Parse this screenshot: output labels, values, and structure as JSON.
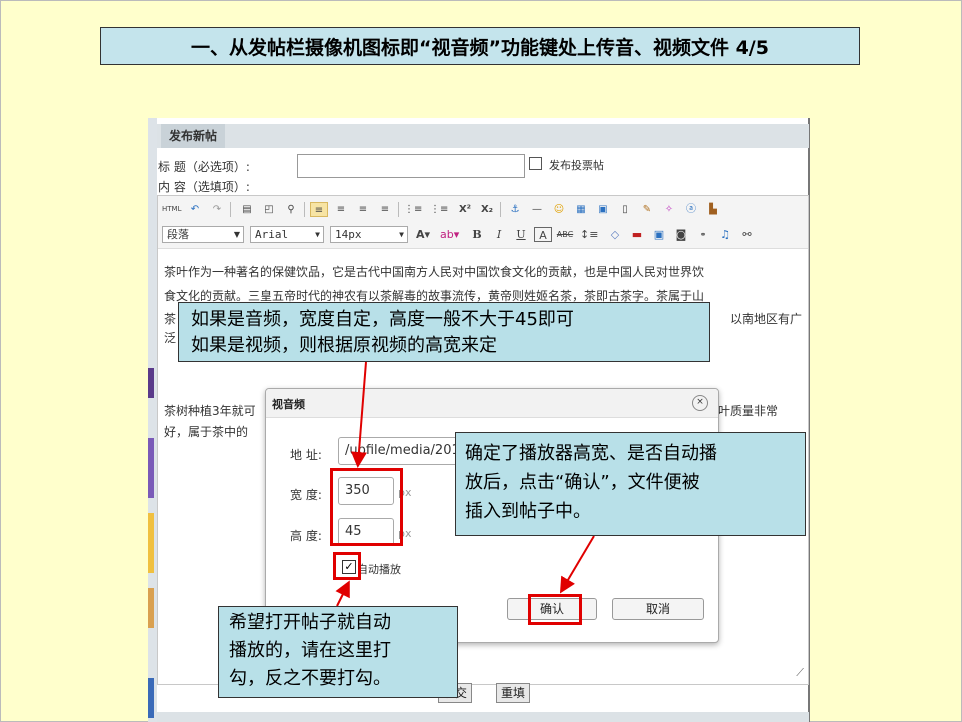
{
  "slide": {
    "title": "一、从发帖栏摄像机图标即“视音频”功能键处上传音、视频文件 4/5"
  },
  "form": {
    "header": "发布新帖",
    "title_label": "标  题（必选项）:",
    "content_label": "内  容（选填项）:",
    "vote_label": "发布投票帖"
  },
  "toolbar": {
    "row1_icons": [
      "html-icon",
      "undo-icon",
      "redo-icon",
      "print-icon",
      "preview-icon",
      "find-icon",
      "align-left-icon",
      "align-center-icon",
      "align-right-icon",
      "justify-icon",
      "ordered-list-icon",
      "unordered-list-icon",
      "superscript-icon",
      "subscript-icon",
      "anchor-icon",
      "hr-icon",
      "emoticon-icon",
      "table-icon",
      "image-icon",
      "file-icon",
      "clean-icon",
      "paste-icon",
      "bold-a-icon",
      "paste-word-icon"
    ],
    "format_select": "段落",
    "font_select": "Arial",
    "size_select": "14px",
    "row2_icons": [
      "font-color-icon",
      "highlight-icon",
      "bold-icon",
      "italic-icon",
      "underline-icon",
      "strikethrough-icon",
      "line-height-icon",
      "eraser-icon",
      "flash-icon",
      "image-upload-icon",
      "media-icon",
      "link-icon",
      "music-icon",
      "more-icon"
    ]
  },
  "editor": {
    "line1": "茶叶作为一种著名的保健饮品，它是古代中国南方人民对中国饮食文化的贡献，也是中国人民对世界饮",
    "line2": "食文化的贡献。三皇五帝时代的神农有以茶解毒的故事流传，黄帝则姓姬名茶，茶即古茶字。茶属于山",
    "line3_start": "茶",
    "line3_end": "以南地区有广",
    "line4_start": "泛",
    "line5": "茶树种植3年就可",
    "line5_end": "叶质量非常",
    "line6": "好，属于茶中的"
  },
  "bottom_buttons": {
    "submit": "提交",
    "reset": "重填"
  },
  "dialog": {
    "title": "视音频",
    "close": "×",
    "address_label": "地  址:",
    "address_value": "/upfile/media/201",
    "width_label": "宽  度:",
    "width_value": "350",
    "height_label": "高  度:",
    "height_value": "45",
    "unit": "px",
    "autoplay_label": "自动播放",
    "autoplay_checked": true,
    "confirm": "确认",
    "cancel": "取消"
  },
  "callouts": {
    "size_line1": "如果是音频，宽度自定，高度一般不大于45即可",
    "size_line2": "如果是视频，则根据原视频的高宽来定",
    "confirm_line1": "确定了播放器高宽、是否自动播",
    "confirm_line2": "放后，点击“确认”，文件便被",
    "confirm_line3": "插入到帖子中。",
    "autoplay_line1": "希望打开帖子就自动",
    "autoplay_line2": "播放的，请在这里打",
    "autoplay_line3": "勾，反之不要打勾。"
  },
  "colors": {
    "slide_background": "#ffffcc",
    "callout_fill": "#b8e0e8",
    "highlight_red": "#e00000"
  }
}
